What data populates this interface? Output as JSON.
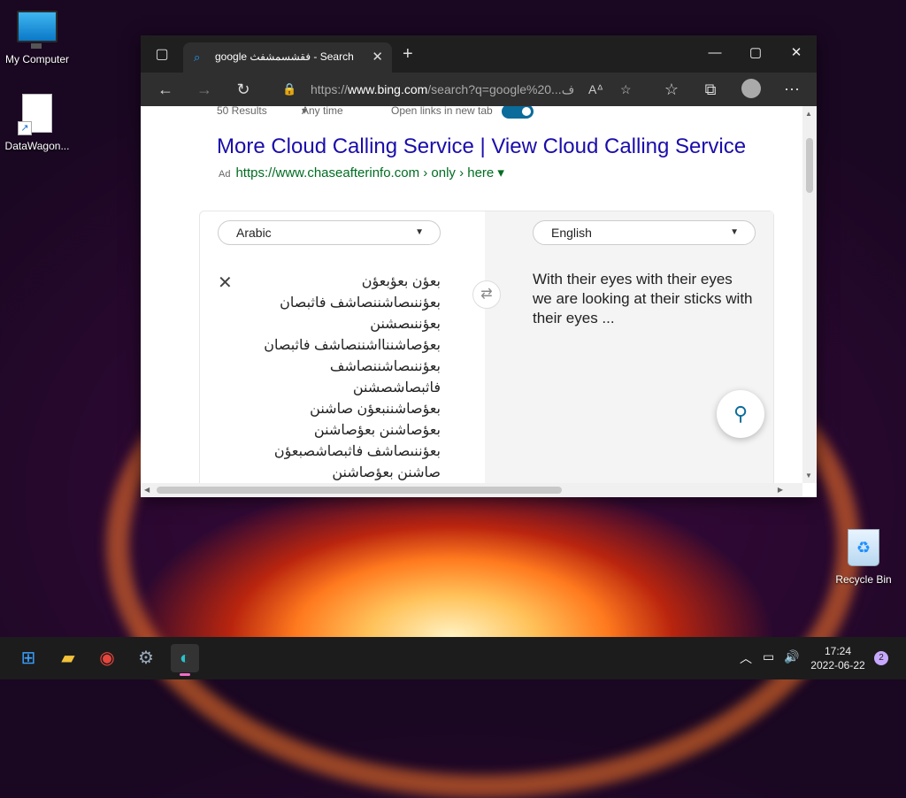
{
  "desktop": {
    "icons": [
      {
        "label": "My Computer"
      },
      {
        "label": "DataWagon..."
      },
      {
        "label": "Recycle Bin"
      }
    ]
  },
  "browser": {
    "tab": {
      "title": "google فقشسمشفث - Search"
    },
    "address": {
      "prefix": "https://",
      "domain": "www.bing.com",
      "rest": "/search?q=google%20...ف"
    },
    "results": {
      "count": "50 Results",
      "time_filter": "Any time",
      "open_links_label": "Open links in new tab",
      "open_links_on": true
    },
    "ad": {
      "title": "More Cloud Calling Service | View Cloud Calling Service",
      "label": "Ad",
      "url": "https://www.chaseafterinfo.com › only › here"
    },
    "translator": {
      "source_lang": "Arabic",
      "target_lang": "English",
      "source_lines": [
        "بعؤن بعؤبعؤن",
        "بعؤننىصاشننصاشف فاثبصان",
        "بعؤننىصشنن",
        "بعؤصاشننااشننصاشف فاثبصان",
        "بعؤننىصاشننصاشف",
        "فاثبصاشصشنن",
        "بعؤصاشننبعؤن صاشنن",
        "بعؤصاشنن بعؤصاشنن",
        "بعؤننىصاشف فاثبصاشصبعؤن",
        "صاشنن بعؤصاشنن"
      ],
      "translation": "With their eyes with their eyes we are looking at their sticks with their eyes ..."
    }
  },
  "taskbar": {
    "time": "17:24",
    "date": "2022-06-22",
    "notifications": "2"
  },
  "colors": {
    "link": "#1a0dab",
    "ad_url": "#006d21",
    "accent": "#0b6b9a"
  }
}
